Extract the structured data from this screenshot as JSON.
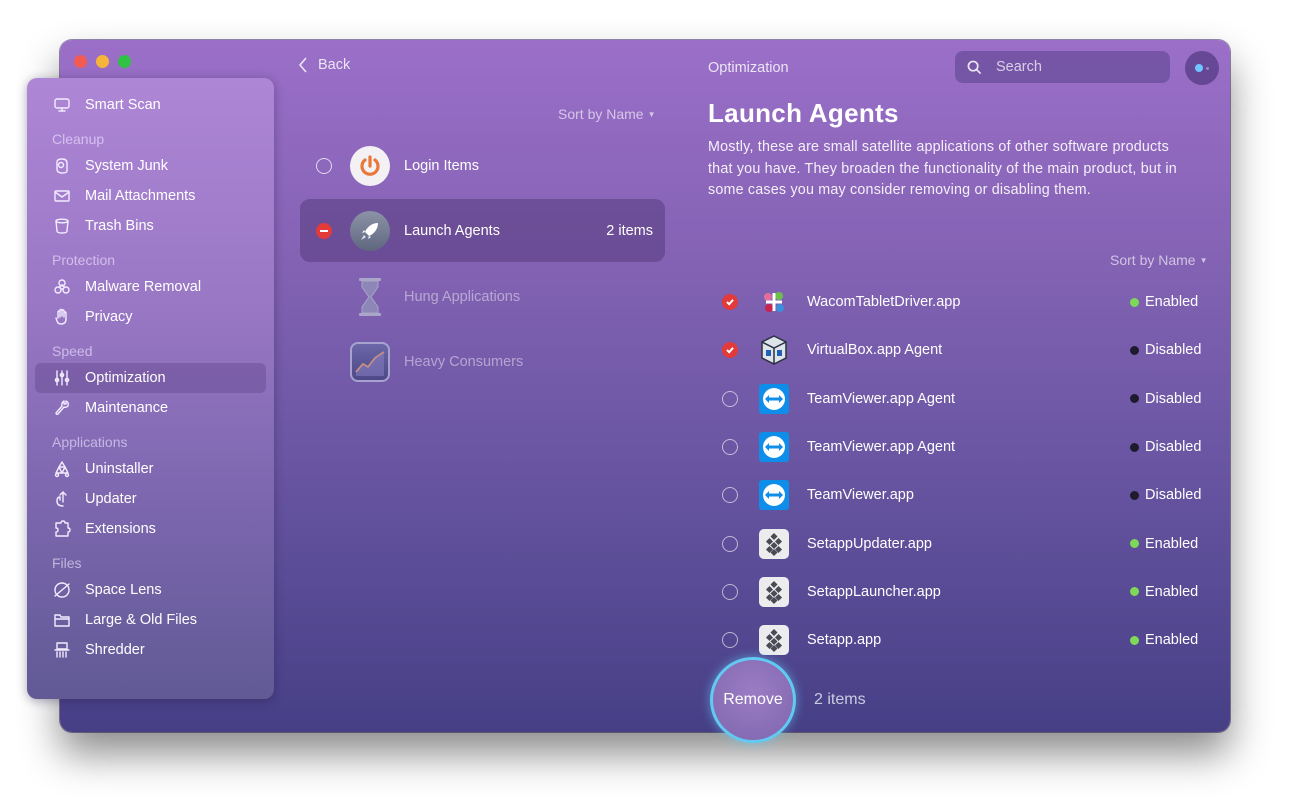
{
  "window": {
    "breadcrumb": "Optimization",
    "back_label": "Back"
  },
  "sidebar": {
    "top_item": {
      "label": "Smart Scan",
      "icon": "monitor-icon"
    },
    "sections": [
      {
        "title": "Cleanup",
        "items": [
          {
            "label": "System Junk",
            "icon": "system-junk-icon"
          },
          {
            "label": "Mail Attachments",
            "icon": "mail-icon"
          },
          {
            "label": "Trash Bins",
            "icon": "trash-icon"
          }
        ]
      },
      {
        "title": "Protection",
        "items": [
          {
            "label": "Malware Removal",
            "icon": "biohazard-icon"
          },
          {
            "label": "Privacy",
            "icon": "hand-icon"
          }
        ]
      },
      {
        "title": "Speed",
        "items": [
          {
            "label": "Optimization",
            "icon": "sliders-icon",
            "active": true
          },
          {
            "label": "Maintenance",
            "icon": "wrench-icon"
          }
        ]
      },
      {
        "title": "Applications",
        "items": [
          {
            "label": "Uninstaller",
            "icon": "uninstaller-icon"
          },
          {
            "label": "Updater",
            "icon": "updater-icon"
          },
          {
            "label": "Extensions",
            "icon": "puzzle-icon"
          }
        ]
      },
      {
        "title": "Files",
        "items": [
          {
            "label": "Space Lens",
            "icon": "planet-icon"
          },
          {
            "label": "Large & Old Files",
            "icon": "folder-icon"
          },
          {
            "label": "Shredder",
            "icon": "shredder-icon"
          }
        ]
      }
    ]
  },
  "categories": {
    "sort_label": "Sort by Name",
    "items": [
      {
        "label": "Login Items",
        "count": "",
        "state": "unchecked",
        "icon": "power-icon"
      },
      {
        "label": "Launch Agents",
        "count": "2 items",
        "state": "partial",
        "icon": "rocket-icon",
        "selected": true
      },
      {
        "label": "Hung Applications",
        "count": "",
        "state": "none",
        "icon": "hourglass-icon",
        "dimmed": true
      },
      {
        "label": "Heavy Consumers",
        "count": "",
        "state": "none",
        "icon": "activity-chart-icon",
        "dimmed": true
      }
    ]
  },
  "detail": {
    "title": "Launch Agents",
    "description": "Mostly, these are small satellite applications of other software products that you have. They broaden the functionality of the main product, but in some cases you may consider removing or disabling them.",
    "sort_label": "Sort by Name",
    "search_placeholder": "Search",
    "agents": [
      {
        "name": "WacomTabletDriver.app",
        "status": "Enabled",
        "checked": true,
        "icon": "wacom-icon"
      },
      {
        "name": "VirtualBox.app Agent",
        "status": "Disabled",
        "checked": true,
        "icon": "virtualbox-icon"
      },
      {
        "name": "TeamViewer.app Agent",
        "status": "Disabled",
        "checked": false,
        "icon": "teamviewer-icon"
      },
      {
        "name": "TeamViewer.app Agent",
        "status": "Disabled",
        "checked": false,
        "icon": "teamviewer-icon"
      },
      {
        "name": "TeamViewer.app",
        "status": "Disabled",
        "checked": false,
        "icon": "teamviewer-icon"
      },
      {
        "name": "SetappUpdater.app",
        "status": "Enabled",
        "checked": false,
        "icon": "setapp-icon"
      },
      {
        "name": "SetappLauncher.app",
        "status": "Enabled",
        "checked": false,
        "icon": "setapp-icon"
      },
      {
        "name": "Setapp.app",
        "status": "Enabled",
        "checked": false,
        "icon": "setapp-icon"
      }
    ],
    "status_colors": {
      "Enabled": "#7ed957",
      "Disabled": "#1e1b2e"
    }
  },
  "footer": {
    "remove_label": "Remove",
    "selected_count": "2 items"
  },
  "colors": {
    "accent_ring": "#62c9f2",
    "check_red": "#e33a3a"
  }
}
